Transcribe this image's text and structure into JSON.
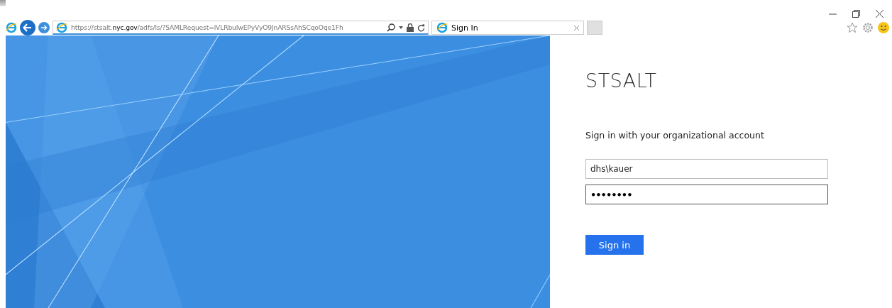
{
  "browser": {
    "address": "https://stsalt.**nyc.gov**/adfs/ls/?SAMLRequest=lVLRbuIwEPyVyO9JnARSsAhSCqoOqe1Fh",
    "tabs": [
      {
        "label": "Sign In",
        "selected": true
      },
      {
        "selected": false
      }
    ]
  },
  "page": {
    "title": "STSALT",
    "prompt": "Sign in with your organizational account",
    "fields": [
      {
        "kind": "text",
        "value": "dhs\\kauer",
        "focused": false
      },
      {
        "kind": "password",
        "value": "••••••••",
        "focused": true
      }
    ],
    "button": "Sign in"
  }
}
